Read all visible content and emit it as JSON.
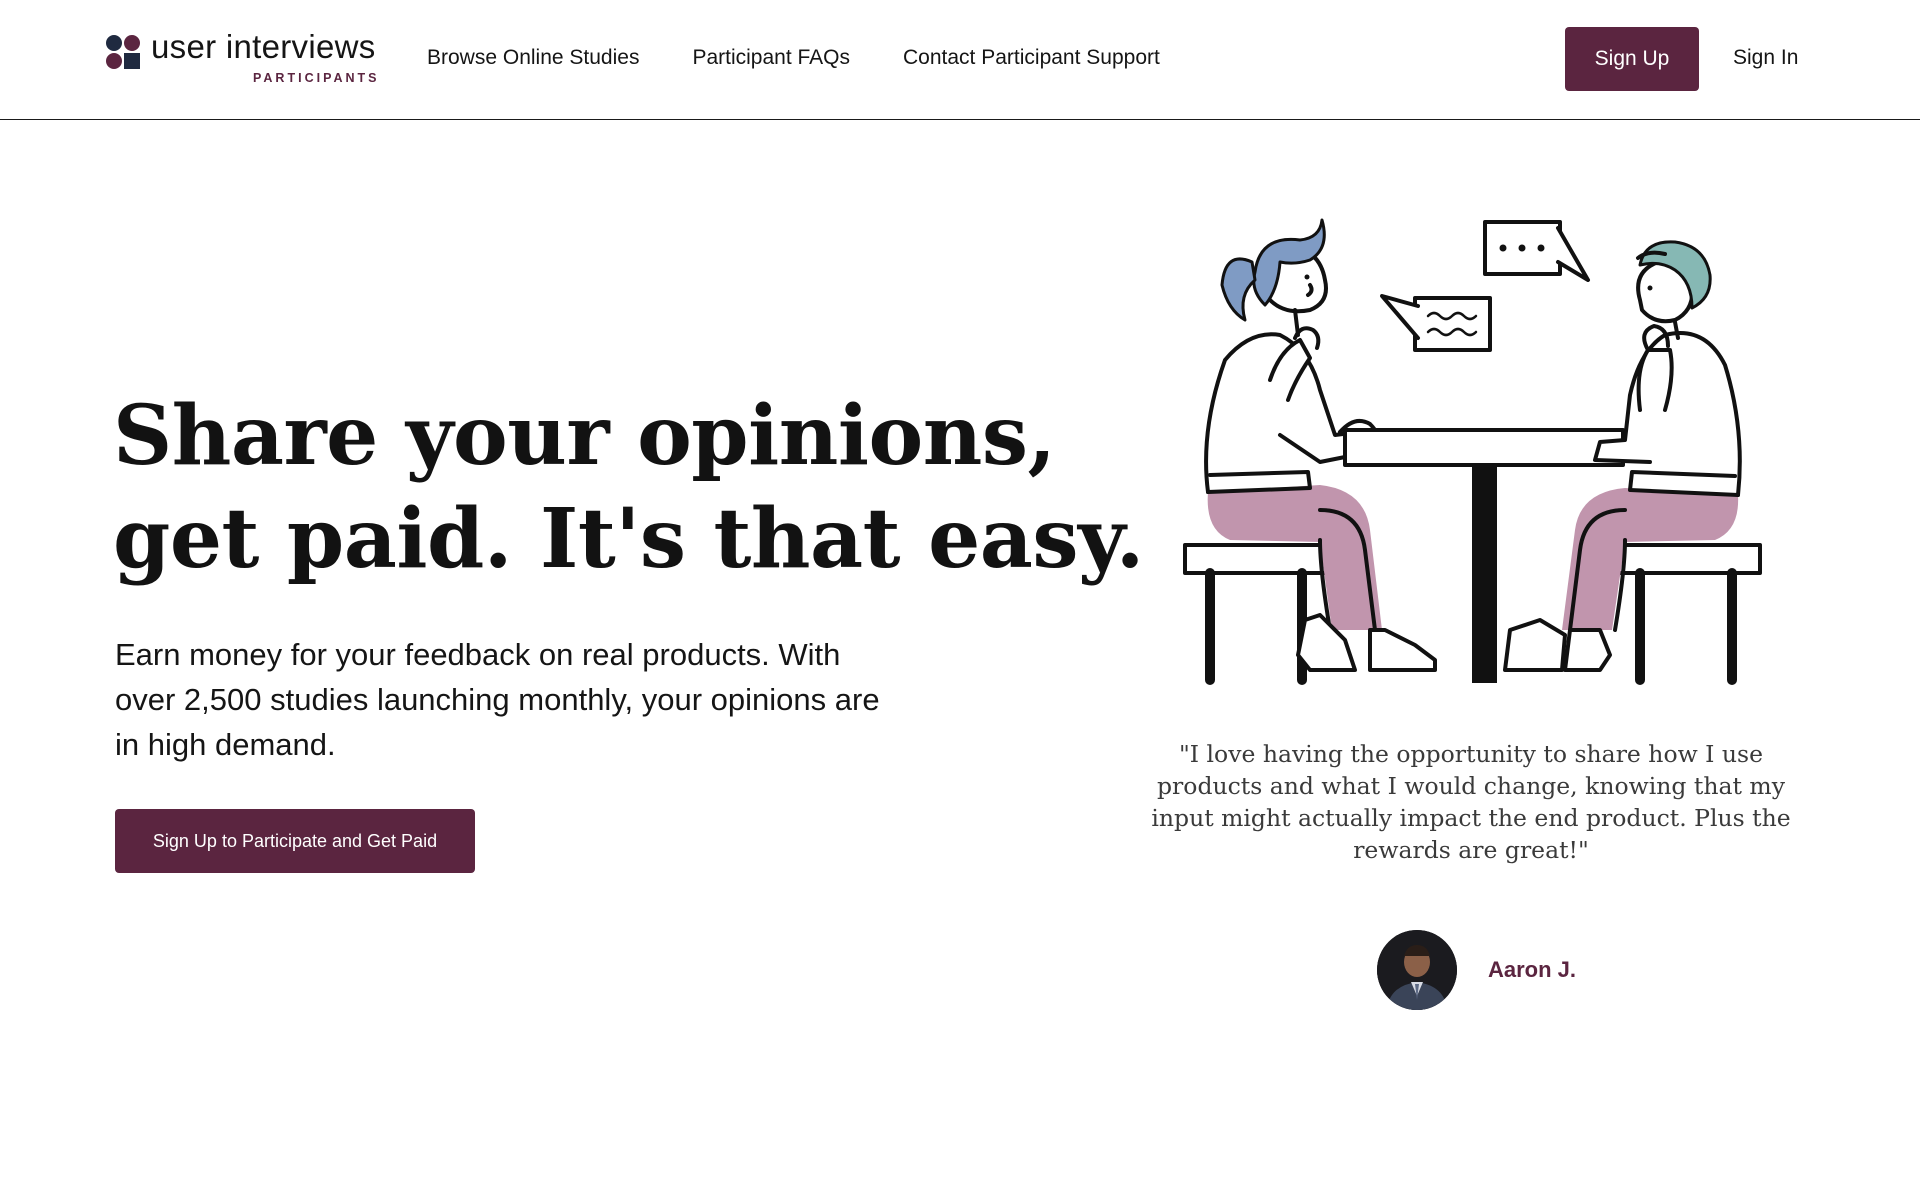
{
  "header": {
    "logo": {
      "wordmark": "user interviews",
      "subtitle": "PARTICIPANTS"
    },
    "nav": [
      {
        "label": "Browse Online Studies"
      },
      {
        "label": "Participant FAQs"
      },
      {
        "label": "Contact Participant Support"
      }
    ],
    "sign_up_label": "Sign Up",
    "sign_in_label": "Sign In"
  },
  "hero": {
    "title_line_1": "Share your opinions,",
    "title_line_2": "get paid. It's that easy.",
    "subtitle": "Earn money for your feedback on real products. With over 2,500 studies launching monthly, your opinions are in high demand.",
    "cta_label": "Sign Up to Participate and Get Paid"
  },
  "testimonial": {
    "quote": "\"I love having the opportunity to share how I use products and what I would change, knowing that my input might actually impact the end product. Plus the rewards are great!\"",
    "author": "Aaron J."
  },
  "colors": {
    "brand": "#5b2540",
    "hair_blue": "#7f9bc4",
    "hair_teal": "#86b8b4",
    "pants_mauve": "#c195ad"
  }
}
